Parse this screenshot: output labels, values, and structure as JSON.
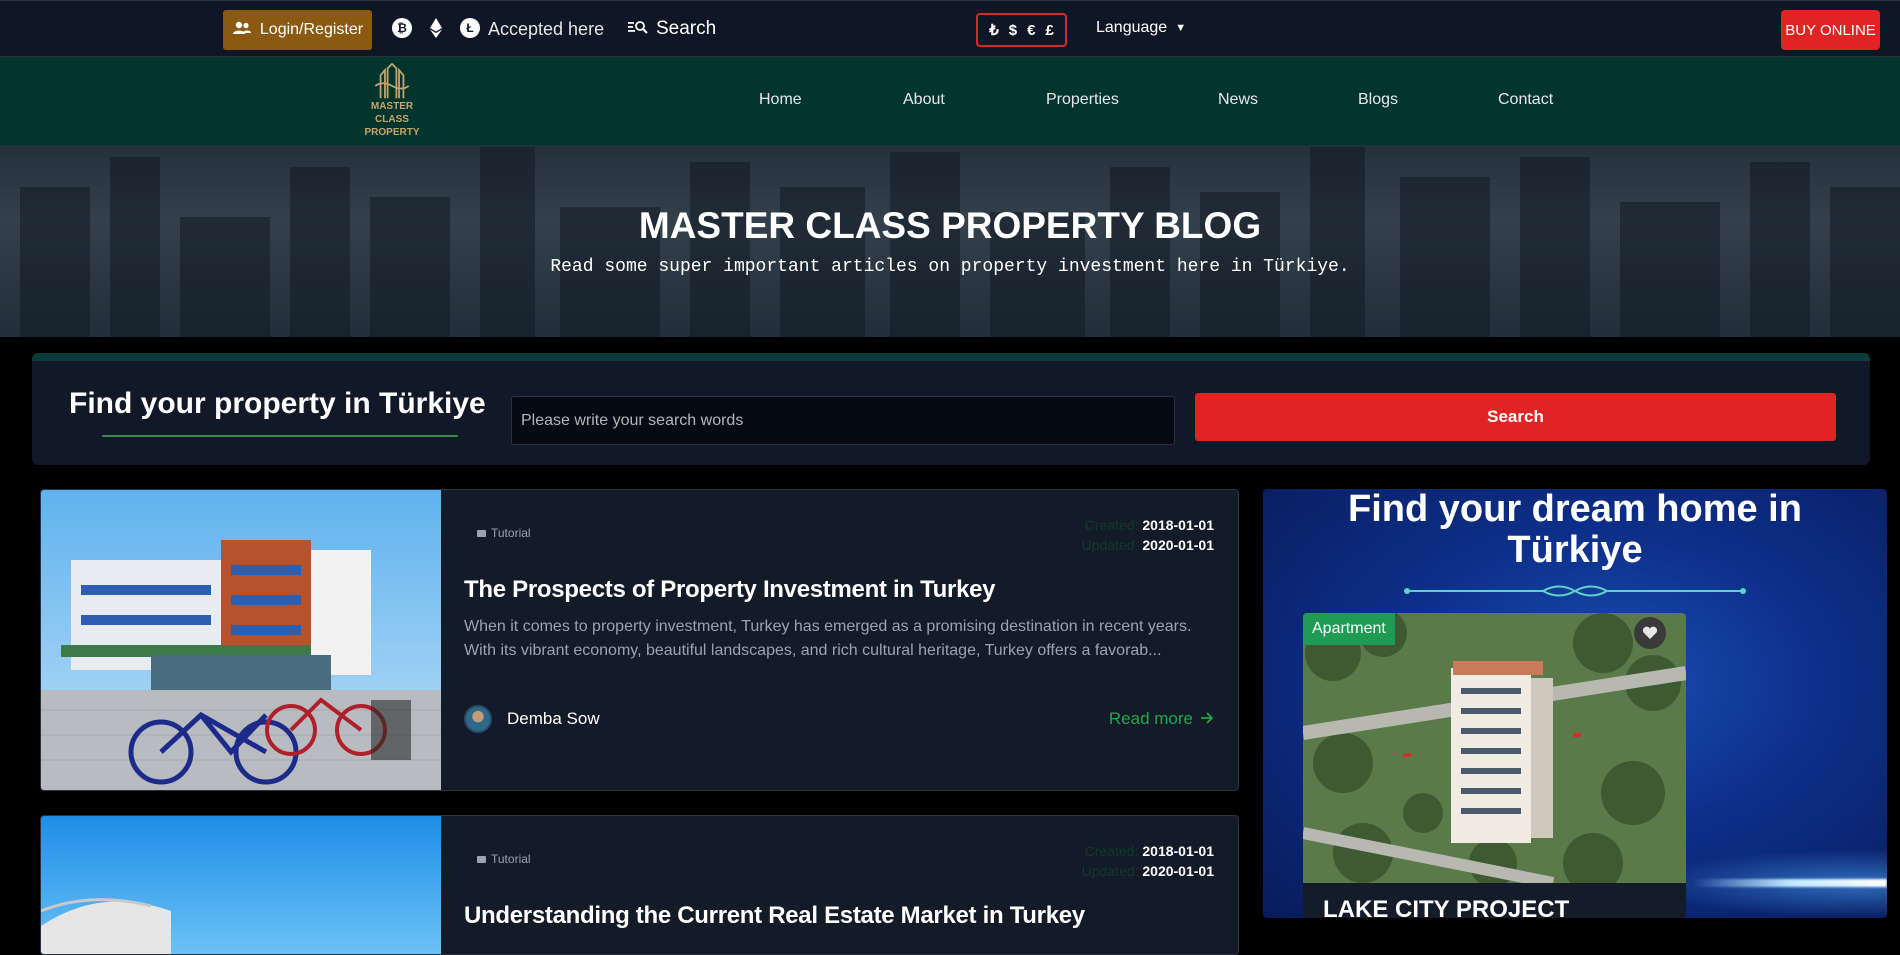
{
  "topbar": {
    "login_label": "Login/Register",
    "crypto_icons": [
      "bitcoin-icon",
      "ethereum-icon",
      "litecoin-icon"
    ],
    "accepted_text": "Accepted here",
    "search_label": "Search",
    "currencies": [
      "₺",
      "$",
      "€",
      "£"
    ],
    "language_label": "Language",
    "buy_label": "BUY ONLINE"
  },
  "brand": {
    "logo_line1": "MASTER CLASS",
    "logo_line2": "PROPERTY"
  },
  "nav": {
    "items": [
      "Home",
      "About",
      "Properties",
      "News",
      "Blogs",
      "Contact"
    ]
  },
  "hero": {
    "title": "MASTER CLASS PROPERTY BLOG",
    "subtitle": "Read some super important articles on property investment here in Türkiye."
  },
  "find": {
    "title": "Find your property in Türkiye",
    "placeholder": "Please write your search words",
    "button_label": "Search"
  },
  "posts": [
    {
      "category": "Tutorial",
      "created_label": "Created:",
      "created": "2018-01-01",
      "updated_label": "Updated:",
      "updated": "2020-01-01",
      "title": "The Prospects of Property Investment in Turkey",
      "excerpt": "When it comes to property investment, Turkey has emerged as a promising destination in recent years. With its vibrant economy, beautiful landscapes, and rich cultural heritage, Turkey offers a favorab...",
      "author": "Demba Sow",
      "read_more": "Read more"
    },
    {
      "category": "Tutorial",
      "created_label": "Created:",
      "created": "2018-01-01",
      "updated_label": "Updated:",
      "updated": "2020-01-01",
      "title": "Understanding the Current Real Estate Market in Turkey"
    }
  ],
  "widget": {
    "title_line1": "Find your dream home in",
    "title_line2": "Türkiye",
    "property": {
      "tag": "Apartment",
      "name": "LAKE CITY PROJECT"
    }
  },
  "colors": {
    "topbar_bg": "#0f1626",
    "nav_bg": "#03352f",
    "accent_red": "#e02424",
    "accent_green": "#22a845",
    "login_bg": "#8a5a12",
    "card_bg": "#131a28"
  }
}
